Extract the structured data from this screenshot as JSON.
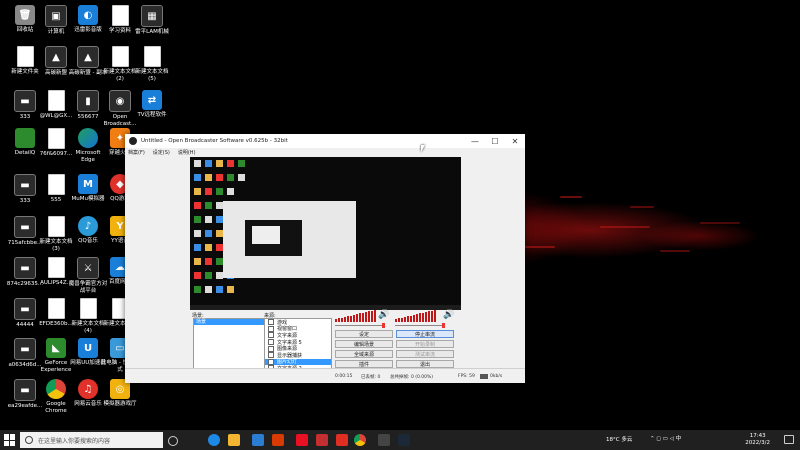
{
  "desktop": {
    "icons": [
      {
        "label": "回收站",
        "glyph": "🗑",
        "icon": "recycle-bin-icon"
      },
      {
        "label": "计算机",
        "glyph": "▣",
        "icon": "computer-icon"
      },
      {
        "label": "迅雷影音版",
        "glyph": "◐",
        "icon": "thunder-player-icon"
      },
      {
        "label": "学习资料",
        "glyph": "",
        "icon": "document-icon"
      },
      {
        "label": "雷平LAM机械",
        "glyph": "▦",
        "icon": "archive-icon"
      },
      {
        "label": "新建文件夹",
        "glyph": "",
        "icon": "folder-icon"
      },
      {
        "label": "高碳新盟",
        "glyph": "▲",
        "icon": "app-icon"
      },
      {
        "label": "高碳新盟 - 副本",
        "glyph": "▲",
        "icon": "app-icon"
      },
      {
        "label": "新建文本文档(2)",
        "glyph": "",
        "icon": "document-icon"
      },
      {
        "label": "新建文本文档(5)",
        "glyph": "",
        "icon": "document-icon"
      },
      {
        "label": "333",
        "glyph": "▬",
        "icon": "app-icon"
      },
      {
        "label": "@WL@GX...",
        "glyph": "",
        "icon": "image-icon"
      },
      {
        "label": "556677",
        "glyph": "▮",
        "icon": "bottle-icon"
      },
      {
        "label": "Open Broadcast...",
        "glyph": "◉",
        "icon": "obs-icon"
      },
      {
        "label": "TV远程软件",
        "glyph": "⇄",
        "icon": "teamviewer-icon"
      },
      {
        "label": "DetailQ",
        "glyph": "",
        "icon": "globe-icon"
      },
      {
        "label": "76f&6097...",
        "glyph": "",
        "icon": "image-icon"
      },
      {
        "label": "Microsoft Edge",
        "glyph": "",
        "icon": "edge-icon"
      },
      {
        "label": "穿越火线",
        "glyph": "✦",
        "icon": "game-icon"
      },
      {
        "label": "333",
        "glyph": "▬",
        "icon": "app-icon"
      },
      {
        "label": "555",
        "glyph": "",
        "icon": "phone-icon"
      },
      {
        "label": "MuMu模拟器",
        "glyph": "M",
        "icon": "mumu-icon"
      },
      {
        "label": "QQ游戏",
        "glyph": "◆",
        "icon": "qq-game-icon"
      },
      {
        "label": "715afcbbe...",
        "glyph": "▬",
        "icon": "app-icon"
      },
      {
        "label": "新建文本文档(3)",
        "glyph": "",
        "icon": "document-icon"
      },
      {
        "label": "QQ音乐",
        "glyph": "♪",
        "icon": "qq-music-icon"
      },
      {
        "label": "YY语音",
        "glyph": "Y",
        "icon": "yy-icon"
      },
      {
        "label": "874c29635...",
        "glyph": "▬",
        "icon": "app-icon"
      },
      {
        "label": "AULIPS4Z...",
        "glyph": "",
        "icon": "image-icon"
      },
      {
        "label": "魔兽争霸官方对战平台",
        "glyph": "⚔",
        "icon": "warcraft-icon"
      },
      {
        "label": "百度网盘",
        "glyph": "☁",
        "icon": "baidu-netdisk-icon"
      },
      {
        "label": "44444",
        "glyph": "▬",
        "icon": "app-icon"
      },
      {
        "label": "EFDE360b...",
        "glyph": "",
        "icon": "document-icon"
      },
      {
        "label": "新建文本文档(4)",
        "glyph": "",
        "icon": "document-icon"
      },
      {
        "label": "新建文本文档",
        "glyph": "",
        "icon": "document-icon"
      },
      {
        "label": "a0634d6d...",
        "glyph": "▬",
        "icon": "app-icon"
      },
      {
        "label": "GeForce Experience",
        "glyph": "◣",
        "icon": "geforce-icon"
      },
      {
        "label": "网易UU加速器",
        "glyph": "U",
        "icon": "uu-icon"
      },
      {
        "label": "此电脑 - 快捷方式",
        "glyph": "▭",
        "icon": "this-pc-icon"
      },
      {
        "label": "ea29eafde...",
        "glyph": "▬",
        "icon": "app-icon"
      },
      {
        "label": "Google Chrome",
        "glyph": "",
        "icon": "chrome-icon"
      },
      {
        "label": "网易云音乐",
        "glyph": "♫",
        "icon": "netease-music-icon"
      },
      {
        "label": "模拟器游戏厅",
        "glyph": "◎",
        "icon": "emulator-icon"
      }
    ]
  },
  "obs": {
    "title": "Untitled - Open Broadcaster Software v0.625b - 32bit",
    "menu": [
      "档案(F)",
      "设定(S)",
      "说明(H)"
    ],
    "labels": {
      "scenes": "场景:",
      "sources": "来源:"
    },
    "scenes": [
      {
        "label": "场景",
        "selected": true
      }
    ],
    "sources": [
      {
        "label": "游戏",
        "selected": false
      },
      {
        "label": "视窗窗口",
        "selected": false
      },
      {
        "label": "文字来源",
        "selected": false
      },
      {
        "label": "文字来源 5",
        "selected": false
      },
      {
        "label": "图像来源",
        "selected": false
      },
      {
        "label": "显示器捕获",
        "selected": false
      },
      {
        "label": "图片幻灯",
        "selected": true
      },
      {
        "label": "文字来源 2",
        "selected": false
      }
    ],
    "buttons": [
      {
        "label": "设定",
        "state": "normal",
        "name": "settings-button"
      },
      {
        "label": "停止串流",
        "state": "active",
        "name": "stop-stream-button"
      },
      {
        "label": "编辑场景",
        "state": "normal",
        "name": "edit-scene-button"
      },
      {
        "label": "开始录制",
        "state": "disabled",
        "name": "start-recording-button"
      },
      {
        "label": "全域来源",
        "state": "normal",
        "name": "global-sources-button"
      },
      {
        "label": "测试串流",
        "state": "disabled",
        "name": "test-stream-button"
      },
      {
        "label": "插件",
        "state": "normal",
        "name": "plugins-button"
      },
      {
        "label": "退出",
        "state": "normal",
        "name": "exit-button"
      }
    ],
    "status": {
      "time": "0:00:15",
      "dropped": "已丢帧: 0",
      "drop_total": "总共掉帧: 0 (0.00%)",
      "fps": "FPS: 59",
      "bitrate": "0kb/s"
    },
    "accent_color": "#3399ff",
    "meter_color": "#c01818"
  },
  "taskbar": {
    "search_placeholder": "在这里输入你要搜索的内容",
    "apps": [
      "task-view-icon",
      "edge-icon",
      "file-explorer-icon",
      "mail-icon",
      "media-icon",
      "game-icon",
      "netease-icon",
      "pdd-icon",
      "chrome-icon",
      "obs-icon",
      "steam-icon"
    ],
    "weather": "18°C 多云",
    "time": "17:43",
    "date": "2022/3/2"
  }
}
